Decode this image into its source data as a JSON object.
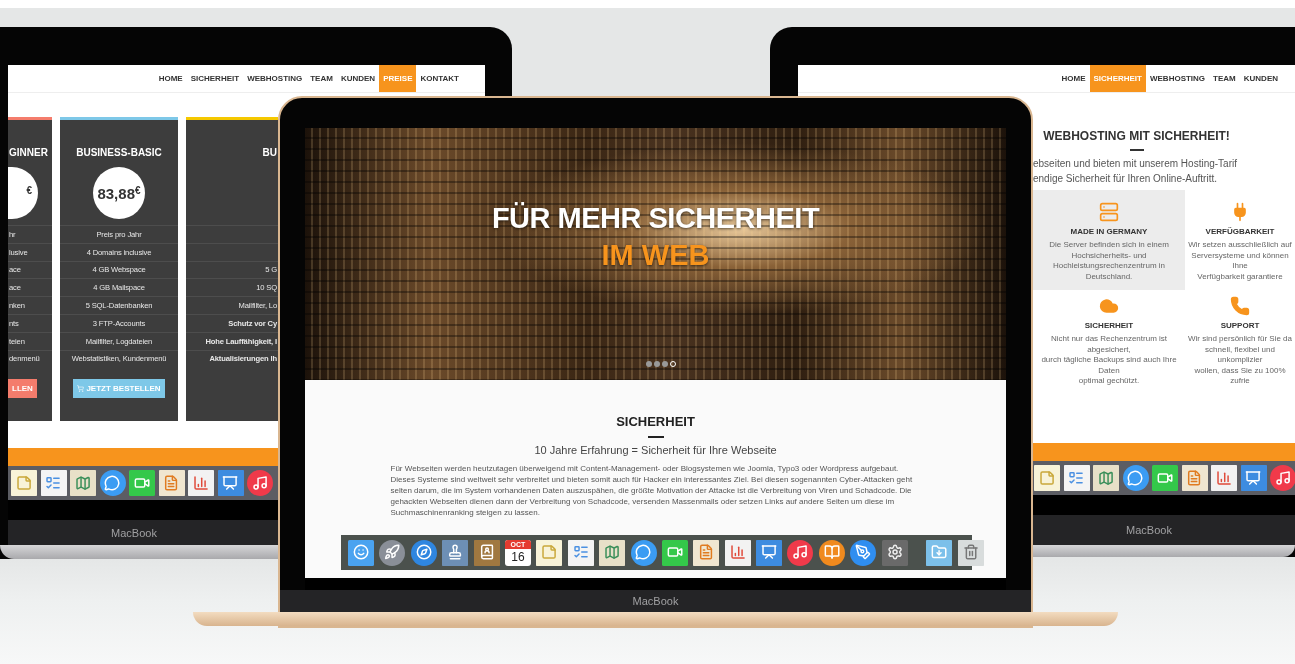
{
  "laptops": [
    {
      "label": "MacBook",
      "site": {
        "kind": "pricing",
        "nav": [
          {
            "label": "HOME",
            "selected": false
          },
          {
            "label": "SICHERHEIT",
            "selected": false
          },
          {
            "label": "WEBHOSTING",
            "selected": false
          },
          {
            "label": "TEAM",
            "selected": false
          },
          {
            "label": "KUNDEN",
            "selected": false
          },
          {
            "label": "PREISE",
            "selected": true
          },
          {
            "label": "KONTAKT",
            "selected": false
          }
        ],
        "plans": [
          {
            "title": "GINNER",
            "currency": "€",
            "color": "#f47c6c",
            "features": [
              {
                "text": "hr",
                "bold": false
              },
              {
                "text": "lusive",
                "bold": false
              },
              {
                "text": "ace",
                "bold": false
              },
              {
                "text": "ace",
                "bold": false
              },
              {
                "text": "nken",
                "bold": false
              },
              {
                "text": "nts",
                "bold": false
              },
              {
                "text": "teien",
                "bold": false
              },
              {
                "text": "denmenü",
                "bold": false
              }
            ],
            "button": "LLEN"
          },
          {
            "title": "BUSINESS-BASIC",
            "price": "83,88",
            "currency": "€",
            "color": "#7ec8e8",
            "features": [
              {
                "text": "Preis pro Jahr",
                "bold": false
              },
              {
                "text": "4 Domains inclusive",
                "bold": false
              },
              {
                "text": "4 GB Webspace",
                "bold": false
              },
              {
                "text": "4 GB Mailspace",
                "bold": false
              },
              {
                "text": "5 SQL-Datenbanken",
                "bold": false
              },
              {
                "text": "3 FTP-Accounts",
                "bold": false
              },
              {
                "text": "Mailfilter, Logdateien",
                "bold": false
              },
              {
                "text": "Webstatistiken, Kundenmenü",
                "bold": false
              }
            ],
            "button": "JETZT BESTELLEN"
          },
          {
            "title": "BU",
            "color": "#f5c800",
            "features": [
              {
                "text": "5 G",
                "bold": false
              },
              {
                "text": "10 SQ",
                "bold": false
              },
              {
                "text": "Mailfilter, Lo",
                "bold": false
              },
              {
                "text": "Schutz vor Cy",
                "bold": true
              },
              {
                "text": "Hohe Lauffähigkeit, I",
                "bold": true
              },
              {
                "text": "Aktualisierungen Ih",
                "bold": true
              }
            ]
          }
        ]
      }
    },
    {
      "label": "MacBook",
      "site": {
        "kind": "landing",
        "hero": {
          "title": "FÜR MEHR SICHERHEIT",
          "highlight": "IM WEB",
          "slides": [
            {
              "selected": false
            },
            {
              "selected": false
            },
            {
              "selected": false
            },
            {
              "selected": true
            }
          ]
        },
        "section": {
          "title": "SICHERHEIT",
          "subtitle": "10 Jahre Erfahrung = Sicherheit für Ihre Webseite",
          "body": "Für Webseiten werden heutzutagen überweigend mit Content-Management- oder Blogsystemen wie Joomla, Typo3 oder Wordpress aufgebaut. Dieses Systeme sind weltweit sehr verbreitet und bieten somit auch für Hacker ein interessantes Ziel. Bei diesen sogenannten Cyber-Attacken geht selten darum, die im System vorhandenen Daten auszuspähen, die größte Motivation der Attacke ist die Verbreitung von Viren und Schadcode. Die gehackten Webseiten dienen dann der Verbreitung von Schadcode, versenden Massenmails oder setzen Links auf andere Seiten um diese im Suchmaschinenranking steigen zu lassen."
        },
        "calendar": {
          "month": "OCT",
          "day": "16"
        }
      }
    },
    {
      "label": "MacBook",
      "site": {
        "kind": "features",
        "nav": [
          {
            "label": "HOME",
            "selected": false
          },
          {
            "label": "SICHERHEIT",
            "selected": true
          },
          {
            "label": "WEBHOSTING",
            "selected": false
          },
          {
            "label": "TEAM",
            "selected": false
          },
          {
            "label": "KUNDEN",
            "selected": false
          }
        ],
        "heading": "WEBHOSTING MIT SICHERHEIT!",
        "intro": "ebseiten und bieten mit unserem Hosting-Tarif\nendige Sicherheit für Ihren Online-Auftritt.",
        "features": [
          {
            "title": "MADE IN GERMANY",
            "text": "Die Server befinden sich in einem\nHochsicherheits- und\nHochleistungsrechenzentrum in Deutschland.",
            "highlighted": true
          },
          {
            "title": "VERFÜGBARKEIT",
            "text": "Wir setzen ausschließlich auf\nServersysteme und können Ihne\nVerfügbarkeit garantiere",
            "highlighted": false
          },
          {
            "title": "SICHERHEIT",
            "text": "Nicht nur das Rechenzentrum ist abgesichert,\ndurch tägliche Backups sind auch Ihre Daten\noptimal gechützt.",
            "highlighted": false
          },
          {
            "title": "SUPPORT",
            "text": "Wir sind persönlich für Sie da\nschnell, flexibel und unkomplizier\nwollen, dass Sie zu 100% zufrie",
            "highlighted": false
          }
        ]
      }
    }
  ]
}
